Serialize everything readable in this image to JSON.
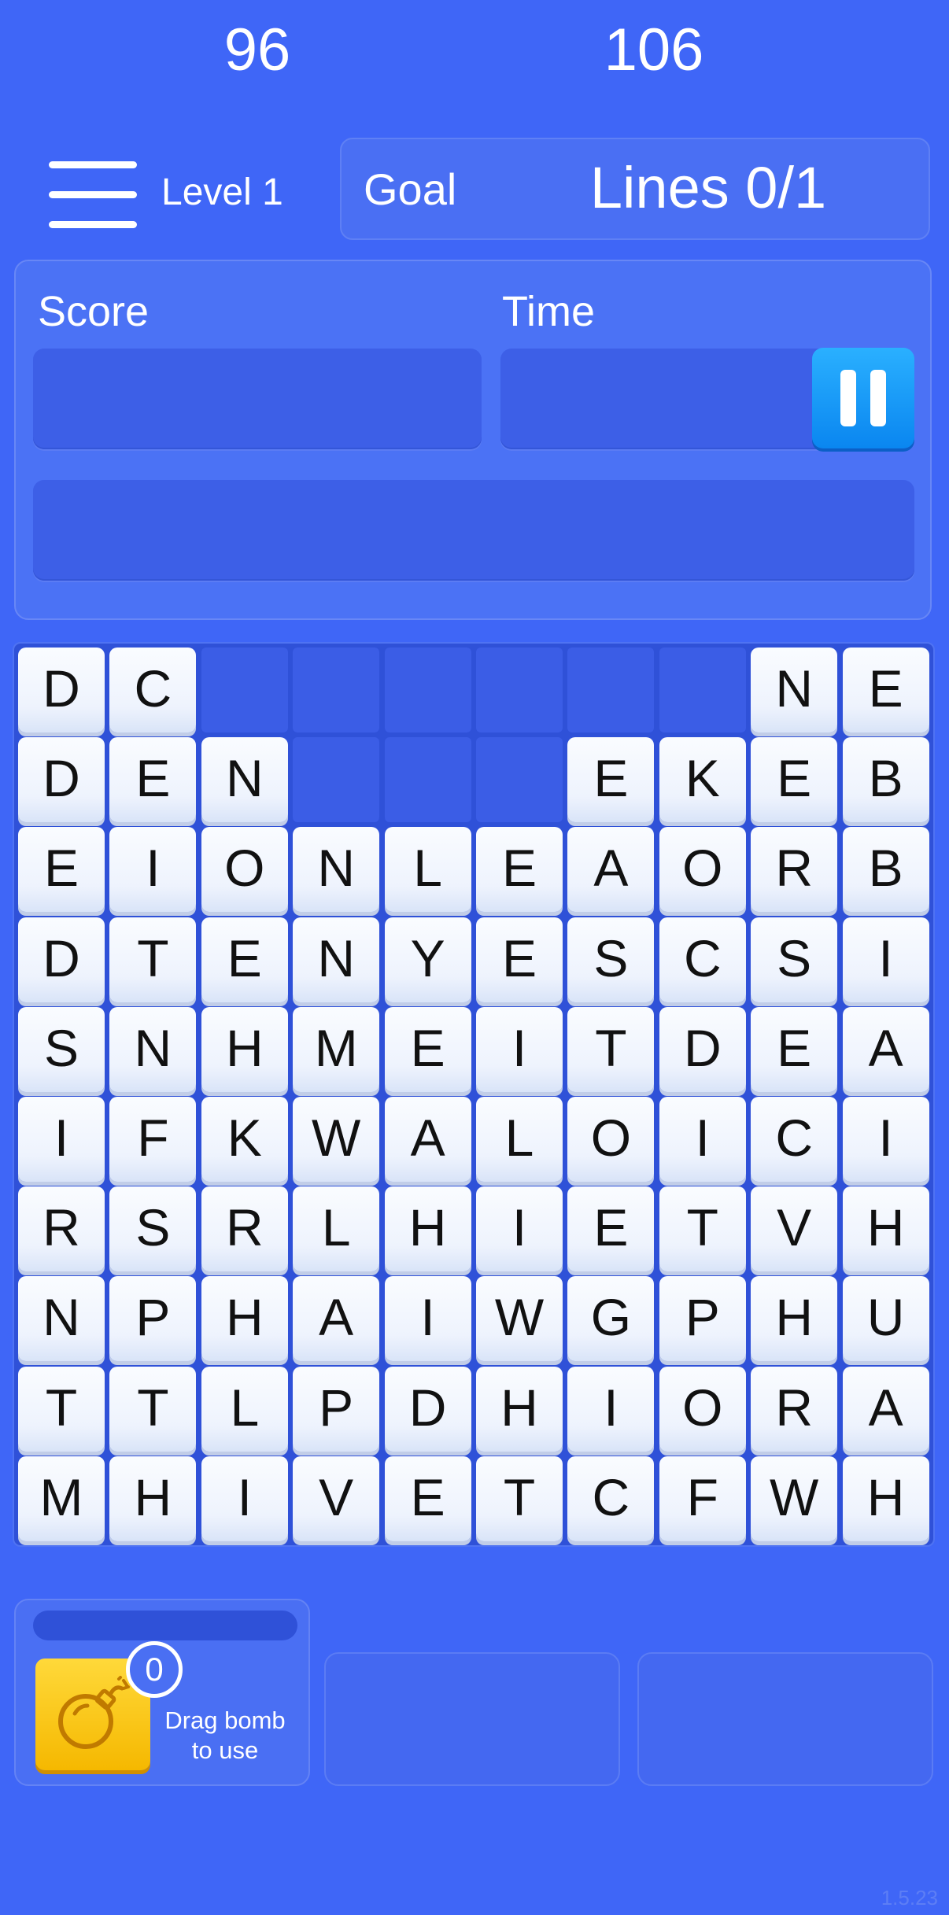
{
  "header": {
    "level_label": "Level 1",
    "goal_label": "Goal",
    "goal_value": "Lines 0/1"
  },
  "stats": {
    "score_label": "Score",
    "score_value": "96",
    "time_label": "Time",
    "time_value": "106",
    "current_word": ""
  },
  "board": {
    "rows": [
      [
        "D",
        "C",
        "",
        "",
        "",
        "",
        "",
        "",
        "N",
        "E"
      ],
      [
        "D",
        "E",
        "N",
        "",
        "",
        "",
        "E",
        "K",
        "E",
        "B"
      ],
      [
        "E",
        "I",
        "O",
        "N",
        "L",
        "E",
        "A",
        "O",
        "R",
        "B"
      ],
      [
        "D",
        "T",
        "E",
        "N",
        "Y",
        "E",
        "S",
        "C",
        "S",
        "I"
      ],
      [
        "S",
        "N",
        "H",
        "M",
        "E",
        "I",
        "T",
        "D",
        "E",
        "A"
      ],
      [
        "I",
        "F",
        "K",
        "W",
        "A",
        "L",
        "O",
        "I",
        "C",
        "I"
      ],
      [
        "R",
        "S",
        "R",
        "L",
        "H",
        "I",
        "E",
        "T",
        "V",
        "H"
      ],
      [
        "N",
        "P",
        "H",
        "A",
        "I",
        "W",
        "G",
        "P",
        "H",
        "U"
      ],
      [
        "T",
        "T",
        "L",
        "P",
        "D",
        "H",
        "I",
        "O",
        "R",
        "A"
      ],
      [
        "M",
        "H",
        "I",
        "V",
        "E",
        "T",
        "C",
        "F",
        "W",
        "H"
      ]
    ]
  },
  "powerups": {
    "bomb_count": "0",
    "bomb_icon": "bomb-icon",
    "bomb_hint": "Drag bomb to use"
  },
  "version": "1.5.23",
  "colors": {
    "background": "#3f66f7",
    "tile": "#f4f7fe",
    "pause": "#1a9cf8",
    "bomb": "#ffcc1a"
  }
}
